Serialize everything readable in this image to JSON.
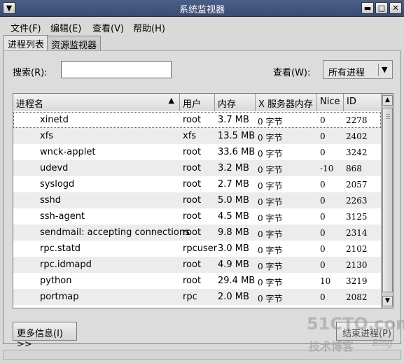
{
  "window": {
    "title": "系统监视器",
    "buttons": [
      "menu-icon",
      "minimize-icon",
      "maximize-icon",
      "close-icon"
    ]
  },
  "menu": [
    {
      "label": "文件(F)"
    },
    {
      "label": "编辑(E)"
    },
    {
      "label": "查看(V)"
    },
    {
      "label": "帮助(H)"
    }
  ],
  "tabs": [
    {
      "label": "进程列表",
      "active": true
    },
    {
      "label": "资源监视器",
      "active": false
    }
  ],
  "search": {
    "label": "搜索(R):",
    "value": ""
  },
  "view": {
    "label": "查看(W):",
    "selected": "所有进程"
  },
  "table": {
    "columns": [
      "进程名",
      "用户",
      "内存",
      "X 服务器内存",
      "Nice",
      "ID"
    ],
    "rows": [
      {
        "name": "xinetd",
        "user": "root",
        "mem": "3.7 MB",
        "xmem": "0 字节",
        "nice": "0",
        "id": "2278"
      },
      {
        "name": "xfs",
        "user": "xfs",
        "mem": "13.5 MB",
        "xmem": "0 字节",
        "nice": "0",
        "id": "2402"
      },
      {
        "name": "wnck-applet",
        "user": "root",
        "mem": "33.6 MB",
        "xmem": "0 字节",
        "nice": "0",
        "id": "3242"
      },
      {
        "name": "udevd",
        "user": "root",
        "mem": "3.2 MB",
        "xmem": "0 字节",
        "nice": "-10",
        "id": "868"
      },
      {
        "name": "syslogd",
        "user": "root",
        "mem": "2.7 MB",
        "xmem": "0 字节",
        "nice": "0",
        "id": "2057"
      },
      {
        "name": "sshd",
        "user": "root",
        "mem": "5.0 MB",
        "xmem": "0 字节",
        "nice": "0",
        "id": "2263"
      },
      {
        "name": "ssh-agent",
        "user": "root",
        "mem": "4.5 MB",
        "xmem": "0 字节",
        "nice": "0",
        "id": "3125"
      },
      {
        "name": "sendmail: accepting connections",
        "user": "root",
        "mem": "9.8 MB",
        "xmem": "0 字节",
        "nice": "0",
        "id": "2314"
      },
      {
        "name": "rpc.statd",
        "user": "rpcuser",
        "mem": "3.0 MB",
        "xmem": "0 字节",
        "nice": "0",
        "id": "2102"
      },
      {
        "name": "rpc.idmapd",
        "user": "root",
        "mem": "4.9 MB",
        "xmem": "0 字节",
        "nice": "0",
        "id": "2130"
      },
      {
        "name": "python",
        "user": "root",
        "mem": "29.4 MB",
        "xmem": "0 字节",
        "nice": "10",
        "id": "3219"
      },
      {
        "name": "portmap",
        "user": "rpc",
        "mem": "2.0 MB",
        "xmem": "0 字节",
        "nice": "0",
        "id": "2082"
      }
    ]
  },
  "buttons": {
    "more_info": "更多信息(I) >>",
    "end_process": "结束进程(P)"
  },
  "watermark": {
    "line1": "51CTO.com",
    "line2": "技术博客",
    "line3": "Blog"
  },
  "colors": {
    "titlebar": "#3f5178",
    "background": "#d9d9d9",
    "row_alt": "#ececec"
  }
}
